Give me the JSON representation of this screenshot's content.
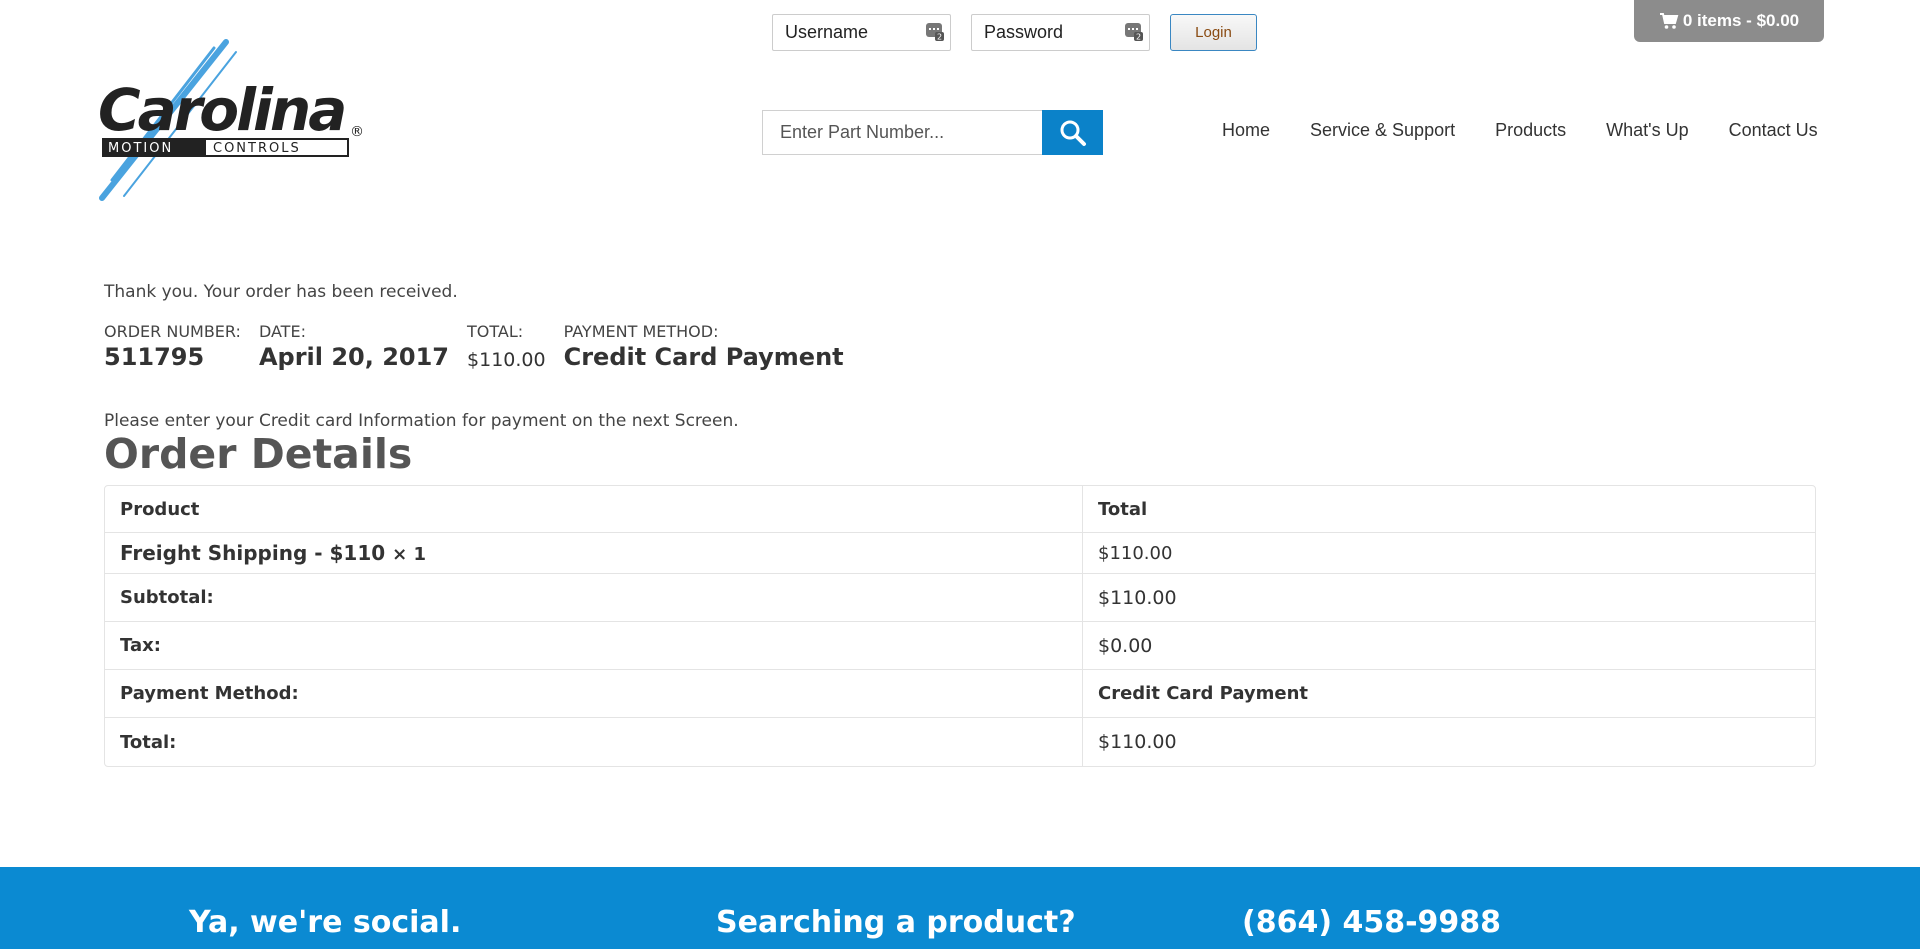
{
  "header": {
    "username_placeholder": "Username",
    "password_placeholder": "Password",
    "login_label": "Login",
    "cart_label": "0 items - $0.00",
    "search_placeholder": "Enter Part Number...",
    "nav": [
      "Home",
      "Service & Support",
      "Products",
      "What's Up",
      "Contact Us"
    ]
  },
  "logo": {
    "name": "Carolina",
    "tagline": "MOTION CONTROLS",
    "brand_color": "#4aa3df"
  },
  "order": {
    "thank_you": "Thank you. Your order has been received.",
    "overview": {
      "number_label": "ORDER NUMBER:",
      "number": "511795",
      "date_label": "DATE:",
      "date": "April 20, 2017",
      "total_label": "TOTAL:",
      "total": "$110.00",
      "method_label": "PAYMENT METHOD:",
      "method": "Credit Card Payment"
    },
    "cc_note": "Please enter your Credit card Information for payment on the next Screen.",
    "details_title": "Order Details",
    "table": {
      "col_product": "Product",
      "col_total": "Total",
      "item_name": "Freight Shipping - $110",
      "item_qty": "× 1",
      "item_total": "$110.00",
      "subtotal_label": "Subtotal:",
      "subtotal": "$110.00",
      "tax_label": "Tax:",
      "tax": "$0.00",
      "method_label": "Payment Method:",
      "method": "Credit Card Payment",
      "total_label": "Total:",
      "total": "$110.00"
    }
  },
  "footer": {
    "social": "Ya, we're social.",
    "search": "Searching a product?",
    "phone": "(864) 458-9988",
    "bg_color": "#0b8ad2"
  }
}
